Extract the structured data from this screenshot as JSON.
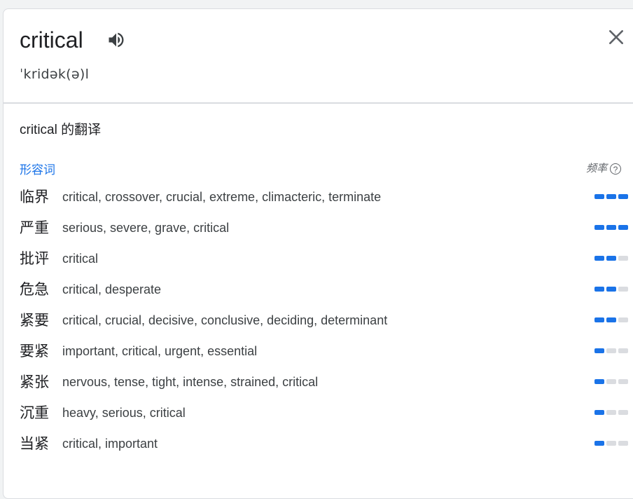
{
  "entry": {
    "word": "critical",
    "phonetic": "ˈkridək(ə)l",
    "speaker_icon": "speaker-icon",
    "close_icon": "close-icon"
  },
  "translations": {
    "title": "critical 的翻译",
    "part_of_speech": "形容词",
    "frequency_label": "频率",
    "help_icon": "help-circle-icon",
    "rows": [
      {
        "cn": "临界",
        "en": "critical, crossover, crucial, extreme, climacteric, terminate",
        "frequency": 3
      },
      {
        "cn": "严重",
        "en": "serious, severe, grave, critical",
        "frequency": 3
      },
      {
        "cn": "批评",
        "en": "critical",
        "frequency": 2
      },
      {
        "cn": "危急",
        "en": "critical, desperate",
        "frequency": 2
      },
      {
        "cn": "紧要",
        "en": "critical, crucial, decisive, conclusive, deciding, determinant",
        "frequency": 2
      },
      {
        "cn": "要紧",
        "en": "important, critical, urgent, essential",
        "frequency": 1
      },
      {
        "cn": "紧张",
        "en": "nervous, tense, tight, intense, strained, critical",
        "frequency": 1
      },
      {
        "cn": "沉重",
        "en": "heavy, serious, critical",
        "frequency": 1
      },
      {
        "cn": "当紧",
        "en": "critical, important",
        "frequency": 1
      }
    ]
  },
  "colors": {
    "accent": "#1a73e8",
    "bar_off": "#dadce0",
    "text": "#202124"
  }
}
